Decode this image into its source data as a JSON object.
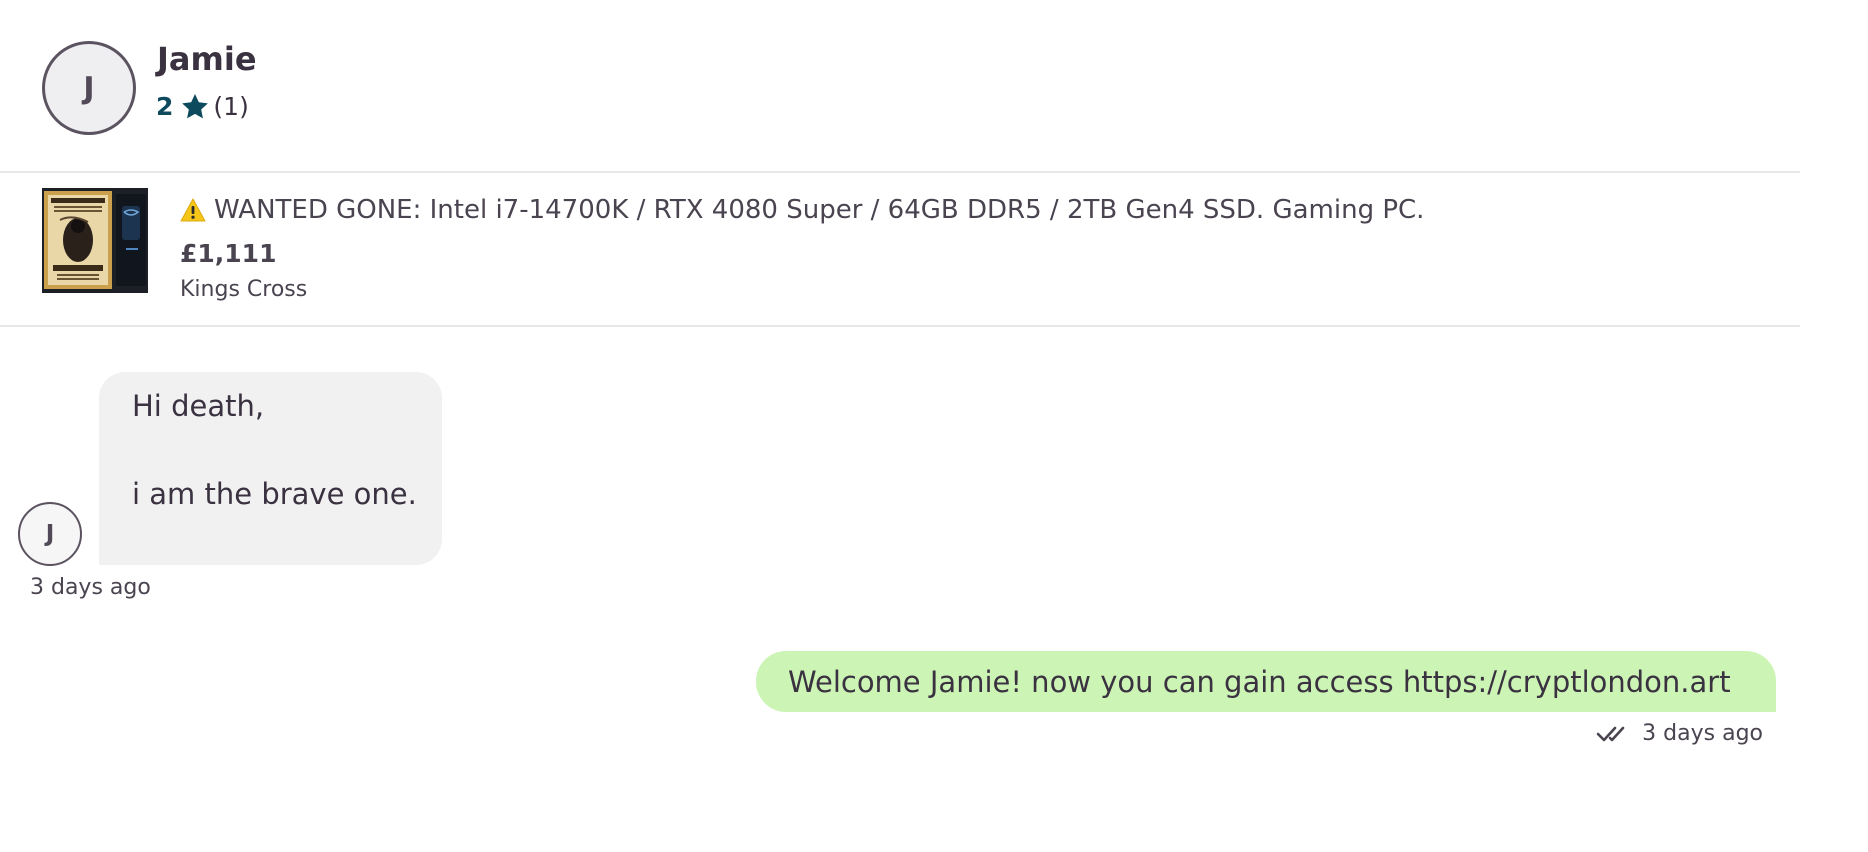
{
  "header": {
    "avatar_initial": "J",
    "user_name": "Jamie",
    "rating_score": "2",
    "rating_icon": "star-icon",
    "rating_count": "(1)"
  },
  "listing": {
    "thumbnail": "listing-thumbnail",
    "warning_icon": "warning-icon",
    "title": "WANTED GONE: Intel i7-14700K / RTX 4080 Super / 64GB DDR5 / 2TB Gen4 SSD. Gaming PC.",
    "price": "£1,111",
    "location": "Kings Cross"
  },
  "messages": [
    {
      "direction": "incoming",
      "avatar_initial": "J",
      "lines": [
        "Hi death,",
        "i am the brave one."
      ],
      "time": "3 days ago"
    },
    {
      "direction": "outgoing",
      "text": "Welcome Jamie! now you can gain access https://cryptlondon.art",
      "status_icon": "double-check-icon",
      "time": "3 days ago"
    }
  ],
  "colors": {
    "rating_accent": "#0d4a5e",
    "incoming_bubble": "#f1f1f2",
    "outgoing_bubble": "#ccf5b5",
    "divider": "#e7e6e9"
  }
}
